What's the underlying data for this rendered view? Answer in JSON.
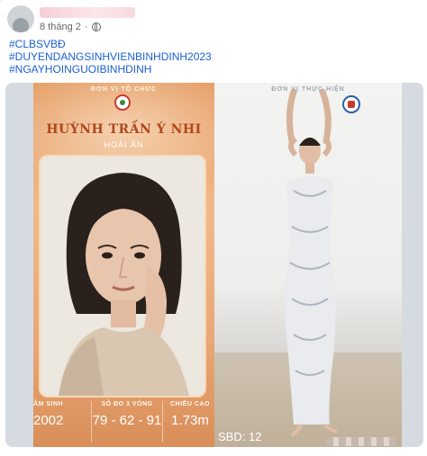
{
  "post": {
    "date": "8 tháng 2",
    "separator": "·",
    "hashtags": [
      "#CLBSVBĐ",
      "#DUYENDANGSINHVIENBINHDINH2023",
      "#NGAYHOINGUOIBINHDINH"
    ]
  },
  "image": {
    "left_panel": {
      "org_label": "ĐƠN VỊ TỔ CHỨC",
      "candidate_name": "HUỲNH TRẦN Ý NHI",
      "hometown": "HOÀI ÂN",
      "stats": [
        {
          "label": "ĂM SINH",
          "value": "2002"
        },
        {
          "label": "SỐ ĐO 3 VÒNG",
          "value": "79 - 62 - 91"
        },
        {
          "label": "CHIỀU CAO",
          "value": "1.73m"
        }
      ]
    },
    "right_panel": {
      "exec_label": "ĐƠN VỊ THỰC HIỆN",
      "sbd": "SBD: 12"
    }
  },
  "colors": {
    "hashtag": "#1c5fd6",
    "meta": "#65676b",
    "name_accent": "#b0461c"
  }
}
